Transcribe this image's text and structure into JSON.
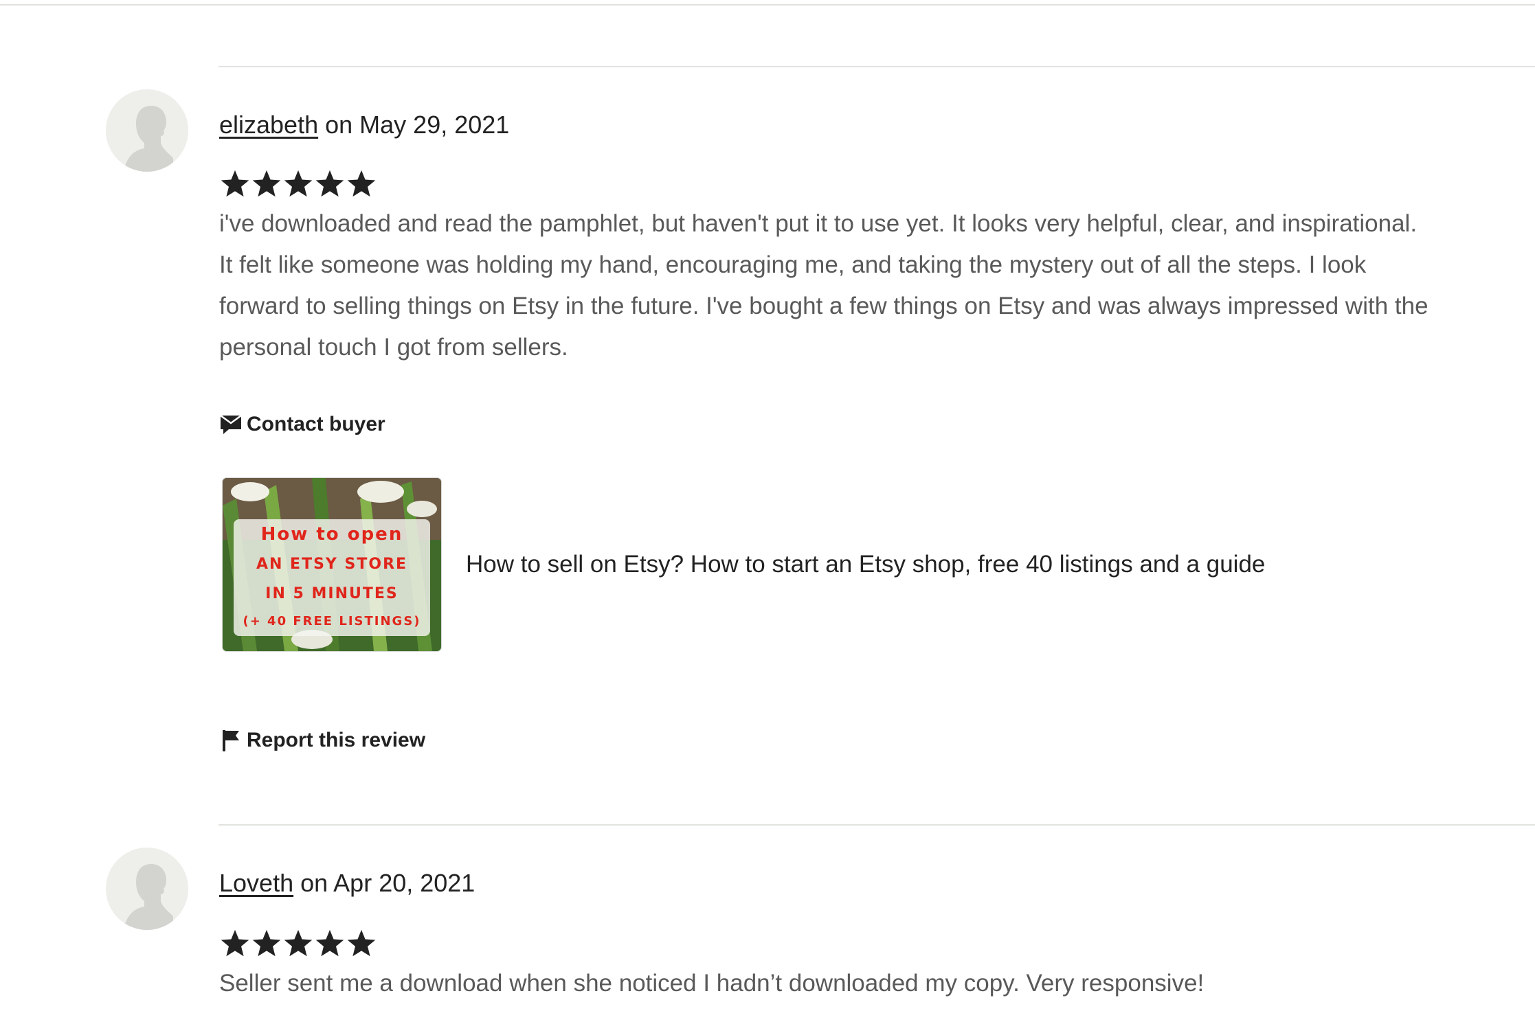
{
  "reviews": [
    {
      "reviewer": "elizabeth",
      "date_text": "on May 29, 2021",
      "rating": 5,
      "text_lines": [
        "i've downloaded and read the pamphlet, but haven't put it to use yet. It looks very helpful, clear, and inspirational.",
        "It felt like someone was holding my hand, encouraging me, and taking the mystery out of all the steps. I look",
        "forward to selling things on Etsy in the future. I've bought a few things on Etsy and was always impressed with the",
        "personal touch I got from sellers."
      ],
      "contact_label": "Contact buyer",
      "listing": {
        "thumb_lines": [
          "How to open",
          "AN ETSY STORE",
          "IN 5 MINUTES",
          "(+ 40 FREE LISTINGS)"
        ],
        "title": "How to sell on Etsy? How to start an Etsy shop, free 40 listings and a guide"
      },
      "report_label": "Report this review"
    },
    {
      "reviewer": "Loveth",
      "date_text": "on Apr 20, 2021",
      "rating": 5,
      "text_lines": [
        "Seller sent me a download when she noticed I hadn’t downloaded my copy. Very responsive!"
      ]
    }
  ],
  "colors": {
    "text_primary": "#222222",
    "text_secondary": "#595959",
    "divider": "#e1e3df",
    "avatar_bg": "#eeefeb",
    "thumb_accent": "#e0251b"
  },
  "icons": {
    "avatar": "user-silhouette-icon",
    "star": "star-filled-icon",
    "contact": "message-icon",
    "report": "flag-icon"
  }
}
